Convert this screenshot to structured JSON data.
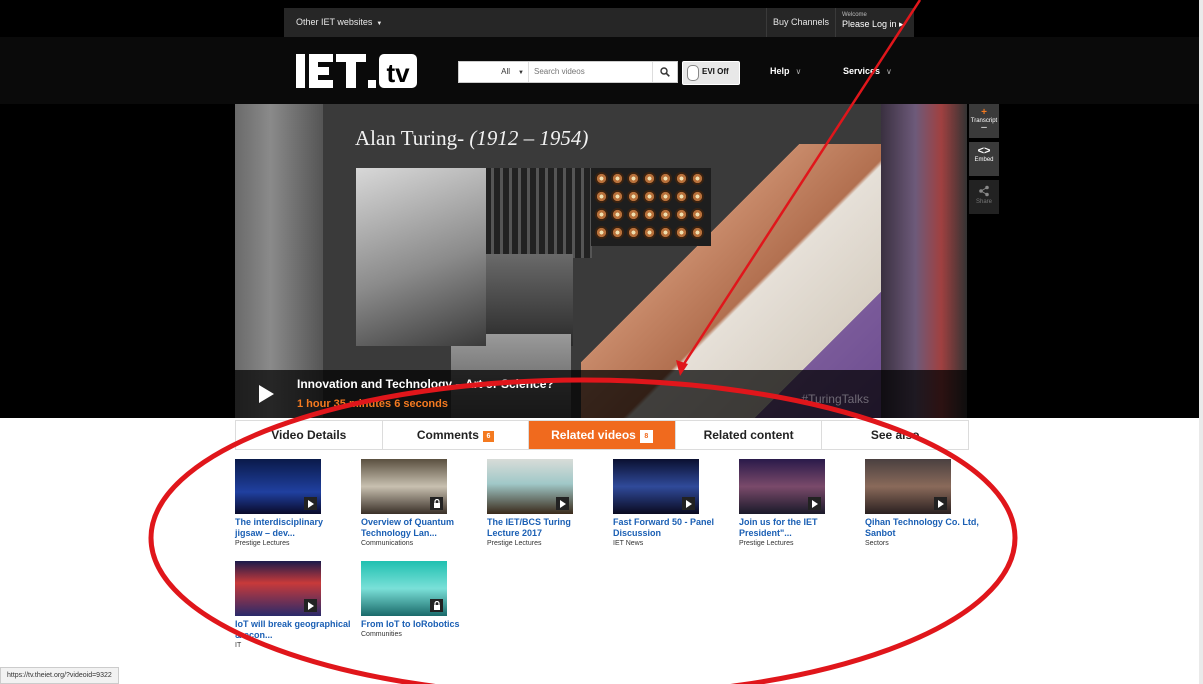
{
  "top_bar": {
    "other_sites": "Other IET websites",
    "buy_channels": "Buy Channels",
    "welcome": "Welcome",
    "login": "Please Log in ▸"
  },
  "header": {
    "logo_text": "IET.tv",
    "search_filter": "All",
    "search_placeholder": "Search videos",
    "evi_label": "EVI Off",
    "help": "Help",
    "services": "Services"
  },
  "player": {
    "slide_name": "Alan Turing-",
    "slide_years": "(1912 – 1954)",
    "title": "Innovation and Technology – Art or Science?",
    "duration": "1 hour 35 minutes 6 seconds",
    "hashtag": "#TuringTalks"
  },
  "side_tools": [
    {
      "icon": "+",
      "label": "Transcript"
    },
    {
      "icon": "<>",
      "label": "Embed"
    },
    {
      "icon": "share",
      "label": "Share"
    }
  ],
  "tabs": [
    {
      "label": "Video Details"
    },
    {
      "label": "Comments",
      "badge": "6"
    },
    {
      "label": "Related videos",
      "badge": "8"
    },
    {
      "label": "Related content"
    },
    {
      "label": "See also"
    }
  ],
  "active_tab": "Related videos",
  "related": [
    {
      "title": "The interdisciplinary jigsaw – dev...",
      "category": "Prestige Lectures",
      "icon": "play"
    },
    {
      "title": "Overview of Quantum Technology Lan...",
      "category": "Communications",
      "icon": "lock"
    },
    {
      "title": "The IET/BCS Turing Lecture 2017",
      "category": "Prestige Lectures",
      "icon": "play"
    },
    {
      "title": "Fast Forward 50 - Panel Discussion",
      "category": "IET News",
      "icon": "play"
    },
    {
      "title": "Join us for the IET President\"...",
      "category": "Prestige Lectures",
      "icon": "play"
    },
    {
      "title": "Qihan Technology Co. Ltd, Sanbot",
      "category": "Sectors",
      "icon": "play"
    },
    {
      "title": "IoT will break geographical & econ...",
      "category": "IT",
      "icon": "play"
    },
    {
      "title": "From IoT to IoRobotics",
      "category": "Communities",
      "icon": "lock"
    }
  ],
  "status_url": "https://tv.theiet.org/?videoid=9322",
  "colors": {
    "accent": "#f06a1e",
    "link": "#1a5fb4",
    "annotation": "#e0161b"
  }
}
